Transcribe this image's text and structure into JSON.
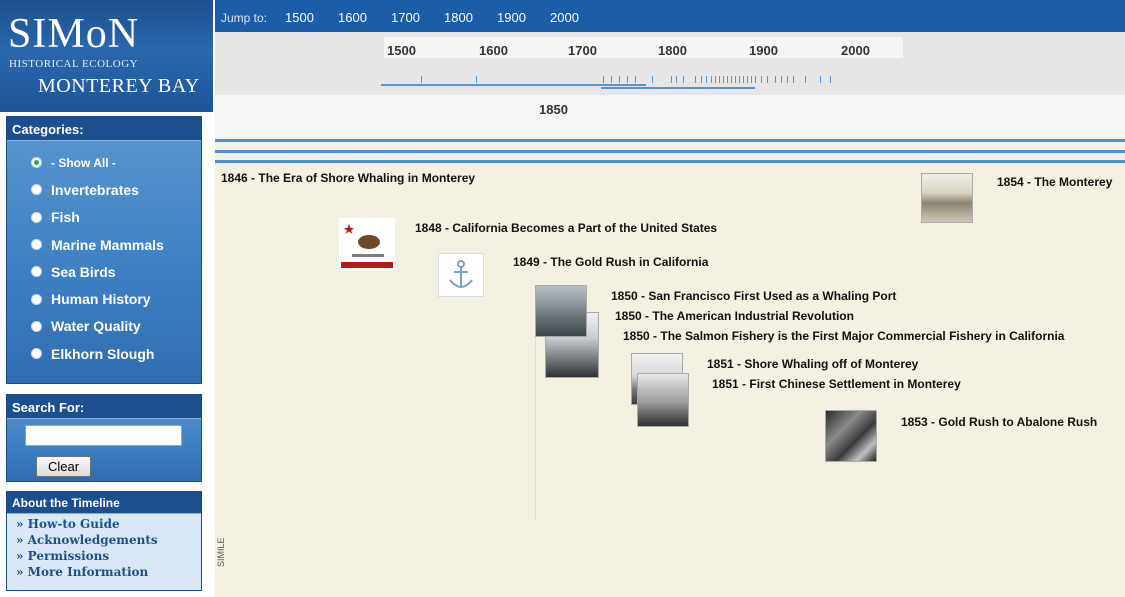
{
  "logo": {
    "line1": "SIMoN",
    "line2": "HISTORICAL ECOLOGY",
    "line3": "MONTEREY BAY"
  },
  "categories": {
    "header": "Categories:",
    "items": [
      {
        "label": "- Show All -",
        "selected": true
      },
      {
        "label": "Invertebrates",
        "selected": false
      },
      {
        "label": "Fish",
        "selected": false
      },
      {
        "label": "Marine Mammals",
        "selected": false
      },
      {
        "label": "Sea Birds",
        "selected": false
      },
      {
        "label": "Human History",
        "selected": false
      },
      {
        "label": "Water Quality",
        "selected": false
      },
      {
        "label": "Elkhorn Slough",
        "selected": false
      }
    ]
  },
  "search": {
    "header": "Search For:",
    "value": "",
    "clear_label": "Clear"
  },
  "about": {
    "header": "About the Timeline",
    "links": [
      "» How-to Guide",
      "» Acknowledgements",
      "» Permissions",
      "» More Information"
    ]
  },
  "jumpbar": {
    "label": "Jump to:",
    "years": [
      "1500",
      "1600",
      "1700",
      "1800",
      "1900",
      "2000"
    ]
  },
  "overview": {
    "years": [
      "1500",
      "1600",
      "1700",
      "1800",
      "1900",
      "2000"
    ]
  },
  "detail": {
    "year": "1850"
  },
  "events": [
    {
      "text": "1846 - The Era of Shore Whaling in Monterey"
    },
    {
      "text": "1854 - The Monterey"
    },
    {
      "text": "1848 - California Becomes a Part of the United States"
    },
    {
      "text": "1849 - The Gold Rush in California"
    },
    {
      "text": "1850 - San Francisco First Used as a Whaling Port"
    },
    {
      "text": "1850 - The American Industrial Revolution"
    },
    {
      "text": "1850 - The Salmon Fishery is the First Major Commercial Fishery in California"
    },
    {
      "text": "1851 - Shore Whaling off of Monterey"
    },
    {
      "text": "1851 - First Chinese Settlement in Monterey"
    },
    {
      "text": "1853 - Gold Rush to Abalone Rush"
    }
  ],
  "watermark": "SIMILE",
  "colors": {
    "brand_blue": "#1b5da6",
    "panel_blue": "#3d7fc2",
    "timeline_bg": "#f4f1e2",
    "selected_dot": "#33a34a"
  }
}
